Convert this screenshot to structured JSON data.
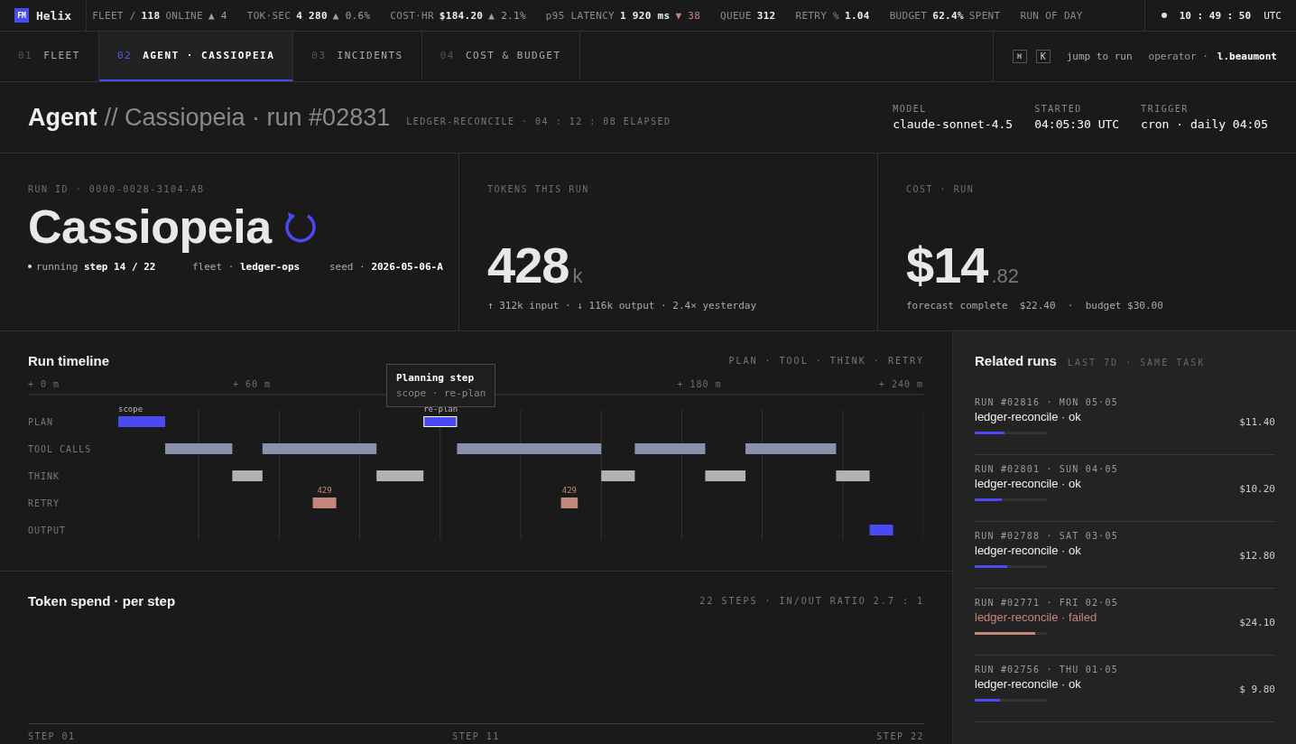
{
  "brand": {
    "logo": "FM",
    "name": "Helix"
  },
  "ticker": [
    {
      "label": "FLEET /",
      "value": "118",
      "suffix": "ONLINE",
      "delta": "▲ 4",
      "color": "#a0a0a0"
    },
    {
      "label": "TOK·SEC",
      "value": "4 280",
      "delta": "▲ 0.6%",
      "color": "#a0a0a0"
    },
    {
      "label": "COST·HR",
      "value": "$184.20",
      "delta": "▲ 2.1%",
      "color": "#a0a0a0"
    },
    {
      "label": "p95 LATENCY",
      "value": "1 920 ms",
      "delta": "▼ 38",
      "color": "#c4887a"
    },
    {
      "label": "QUEUE",
      "value": "312"
    },
    {
      "label": "RETRY %",
      "value": "1.04"
    },
    {
      "label": "BUDGET",
      "value": "62.4%",
      "suffix": "SPENT"
    },
    {
      "label": "RUN OF DAY"
    }
  ],
  "clock": {
    "time": "10 : 49 : 50",
    "zone": "UTC"
  },
  "tabs": [
    {
      "number": "01",
      "label": "FLEET",
      "selected": false
    },
    {
      "number": "02",
      "label": "AGENT · CASSIOPEIA",
      "selected": true
    },
    {
      "number": "03",
      "label": "INCIDENTS",
      "selected": false
    },
    {
      "number": "04",
      "label": "COST & BUDGET",
      "selected": false
    }
  ],
  "shortcut": {
    "keys": [
      "⌘",
      "K"
    ],
    "label": "jump to run"
  },
  "operator": {
    "label": "operator ·",
    "name": "l.beaumont"
  },
  "header": {
    "title": "Agent",
    "subtitle": "// Cassiopeia · run #02831",
    "meta": "LEDGER-RECONCILE · 04 : 12 : 08 ELAPSED",
    "fields": [
      {
        "label": "MODEL",
        "value": "claude-sonnet-4.5"
      },
      {
        "label": "STARTED",
        "value": "04:05:30 UTC"
      },
      {
        "label": "TRIGGER",
        "value": "cron · daily 04:05"
      }
    ]
  },
  "run_card": {
    "label": "RUN ID · 0000-0028-3104-AB",
    "name": "Cassiopeia",
    "meta": [
      {
        "kind": "status",
        "label": "running",
        "value": "step 14 / 22"
      },
      {
        "kind": "field",
        "label": "fleet ·",
        "value": "ledger-ops"
      },
      {
        "kind": "field",
        "label": "seed ·",
        "value": "2026-05-06-A"
      }
    ]
  },
  "tokens_card": {
    "label": "TOKENS THIS RUN",
    "value": "428",
    "unit": "k",
    "detail": "↑ 312k input · ↓ 116k output · 2.4× yesterday"
  },
  "cost_card": {
    "label": "COST · RUN",
    "value": "$14",
    "unit": ".82",
    "detail": "forecast complete  $22.40  ·  budget $30.00"
  },
  "timeline": {
    "title": "Run timeline",
    "legend": "PLAN · TOOL · THINK · RETRY",
    "axis_labels": [
      "+ 0 m",
      "+ 60 m",
      "+ 180 m",
      "+ 240 m"
    ],
    "tooltip": {
      "title": "Planning step",
      "subtitle": "scope · re-plan"
    },
    "lanes": [
      {
        "label": "PLAN",
        "color": "#4a4af2",
        "notes": [
          "scope",
          "re-plan"
        ]
      },
      {
        "label": "TOOL CALLS",
        "color": "#8a91ad"
      },
      {
        "label": "THINK",
        "color": "#b2b2b0"
      },
      {
        "label": "RETRY",
        "color": "#c4887a",
        "notes": [
          "429",
          "429"
        ]
      },
      {
        "label": "OUTPUT",
        "color": "#4a4af2"
      }
    ]
  },
  "token_spend": {
    "title": "Token spend · per step",
    "meta": "22 STEPS · IN/OUT RATIO 2.7 : 1",
    "axis": [
      "STEP 01",
      "STEP 11",
      "STEP 22"
    ]
  },
  "related": {
    "title": "Related runs",
    "subtitle": "LAST 7D · SAME TASK",
    "runs": [
      {
        "meta": "RUN #02816 · MON 05·05",
        "name": "ledger-reconcile · ok",
        "failed": false,
        "cost": "$11.40",
        "level": 0.41
      },
      {
        "meta": "RUN #02801 · SUN 04·05",
        "name": "ledger-reconcile · ok",
        "failed": false,
        "cost": "$10.20",
        "level": 0.37
      },
      {
        "meta": "RUN #02788 · SAT 03·05",
        "name": "ledger-reconcile · ok",
        "failed": false,
        "cost": "$12.80",
        "level": 0.45
      },
      {
        "meta": "RUN #02771 · FRI 02·05",
        "name": "ledger-reconcile · failed",
        "failed": true,
        "cost": "$24.10",
        "level": 0.84
      },
      {
        "meta": "RUN #02756 · THU 01·05",
        "name": "ledger-reconcile · ok",
        "failed": false,
        "cost": "$ 9.80",
        "level": 0.35
      }
    ]
  }
}
